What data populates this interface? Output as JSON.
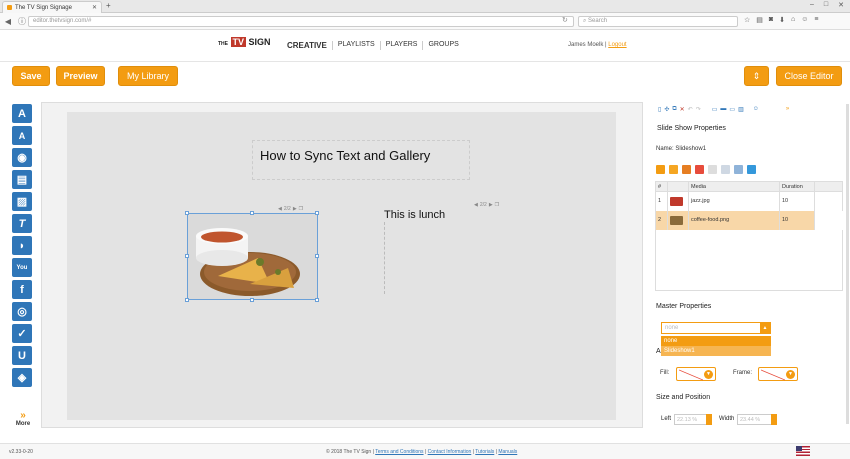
{
  "browser": {
    "tab_title": "The TV Sign Signage",
    "url": "editor.thetvsign.com/#",
    "search_placeholder": "Search"
  },
  "header": {
    "logo_prefix": "THE",
    "logo_tv": "TV",
    "logo_sign": "SIGN",
    "nav": [
      "CREATIVE",
      "PLAYLISTS",
      "PLAYERS",
      "GROUPS"
    ],
    "user_name": "James Moelk",
    "separator": "|",
    "logout": "Logout"
  },
  "toolbar": {
    "save": "Save",
    "preview": "Preview",
    "library": "My Library",
    "close": "Close Editor"
  },
  "palette": {
    "more": "More",
    "tools": [
      {
        "name": "text-tool",
        "glyph": "A"
      },
      {
        "name": "textbox-tool",
        "glyph": "A"
      },
      {
        "name": "image-tool",
        "glyph": "◉"
      },
      {
        "name": "video-tool",
        "glyph": "▤"
      },
      {
        "name": "slideshow-tool",
        "glyph": "▨"
      },
      {
        "name": "ticker-tool",
        "glyph": "T"
      },
      {
        "name": "rss-tool",
        "glyph": "◗"
      },
      {
        "name": "youtube-tool",
        "glyph": "You"
      },
      {
        "name": "facebook-tool",
        "glyph": "f"
      },
      {
        "name": "instagram-tool",
        "glyph": "◎"
      },
      {
        "name": "twitter-tool",
        "glyph": "✓"
      },
      {
        "name": "widget-tool",
        "glyph": "U"
      },
      {
        "name": "3d-tool",
        "glyph": "◈"
      }
    ]
  },
  "canvas": {
    "title_text": "How to Sync Text and Gallery",
    "caption_text": "This is lunch",
    "image_pager": "2/2",
    "text_pager": "2/2"
  },
  "properties": {
    "title": "Slide Show Properties",
    "name_label": "Name: Slideshow1",
    "table": {
      "headers": [
        "#",
        "Media",
        "Duration"
      ],
      "rows": [
        {
          "num": "1",
          "media": "jazz.jpg",
          "duration": "10",
          "thumb_color": "#c0392b"
        },
        {
          "num": "2",
          "media": "coffee-food.png",
          "duration": "10",
          "thumb_color": "#8a6a3a"
        }
      ]
    },
    "master_title": "Master Properties",
    "master_select_value": "none",
    "master_options": [
      "none",
      "Slideshow1"
    ],
    "animation_label": "A",
    "fill_label": "Fill:",
    "frame_label": "Frame:",
    "size_title": "Size and Position",
    "left_label": "Left",
    "left_value": "22.13 %",
    "width_label": "Width",
    "width_value": "23.44 %"
  },
  "footer": {
    "version": "v2.33-0-20",
    "copyright": "© 2018 The TV Sign",
    "links": [
      "Terms and Conditions",
      "Contact Information",
      "Tutorials",
      "Manuals"
    ]
  }
}
